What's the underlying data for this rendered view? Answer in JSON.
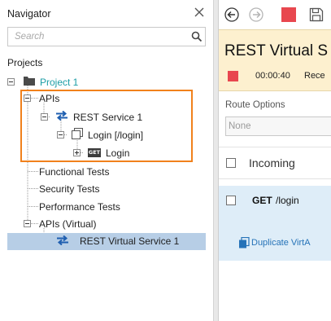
{
  "navigator": {
    "title": "Navigator",
    "search_placeholder": "Search",
    "projects_label": "Projects",
    "tree": {
      "project": "Project 1",
      "apis": "APIs",
      "rest_service": "REST Service 1",
      "login_resource": "Login [/login]",
      "get_badge": "GET",
      "login_operation": "Login",
      "functional_tests": "Functional Tests",
      "security_tests": "Security Tests",
      "performance_tests": "Performance Tests",
      "apis_virtual": "APIs (Virtual)",
      "rest_virtual_service": "REST Virtual Service 1"
    }
  },
  "editor": {
    "title": "REST Virtual S",
    "elapsed_time": "00:00:40",
    "receive_label": "Rece",
    "route_options_label": "Route Options",
    "route_select_value": "None",
    "incoming_label": "Incoming",
    "route": {
      "method": "GET",
      "path": "/login"
    },
    "duplicate_label": "Duplicate VirtA"
  },
  "colors": {
    "accent": "#f1811c",
    "project_link": "#1c9ea6",
    "selection": "#b7cee6",
    "status_panel": "#fdf0cf",
    "stop_red": "#e8474f",
    "route_row": "#deedf8",
    "link_blue": "#2673b8"
  },
  "icons": {
    "close": "close-icon",
    "search": "search-icon",
    "folder": "folder-icon",
    "rest_service": "rest-arrows-icon",
    "resource": "resource-icon",
    "get_badge": "get-badge-icon",
    "back": "back-arrow-icon",
    "forward": "forward-arrow-icon",
    "stop": "stop-icon",
    "save": "save-icon",
    "duplicate": "duplicate-icon"
  }
}
